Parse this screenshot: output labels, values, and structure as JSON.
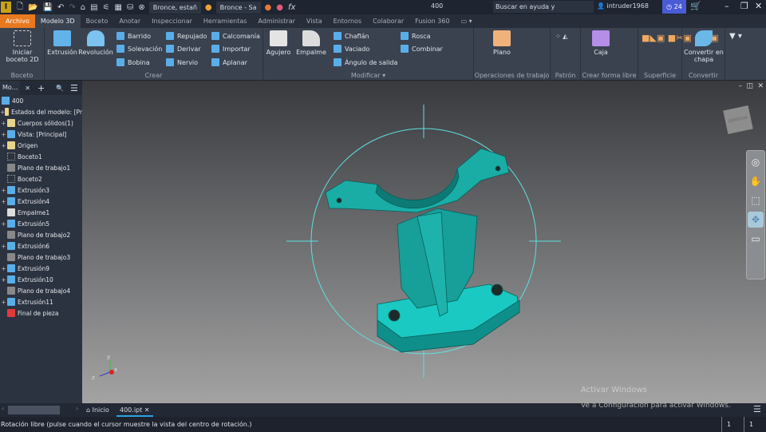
{
  "titlebar": {
    "logo": "I",
    "material": "Bronce, estañ",
    "appearance": "Bronce - Sa",
    "fx": "fx",
    "document": "400",
    "search_placeholder": "Buscar en ayuda y comandos...",
    "user": "intruder1968",
    "notifications": "24"
  },
  "tabs": [
    "Archivo",
    "Modelo 3D",
    "Boceto",
    "Anotar",
    "Inspeccionar",
    "Herramientas",
    "Administrar",
    "Vista",
    "Entornos",
    "Colaborar",
    "Fusion 360"
  ],
  "active_tab": "Modelo 3D",
  "ribbon": {
    "boceto": {
      "label": "Boceto",
      "start": "Iniciar boceto 2D"
    },
    "crear": {
      "label": "Crear",
      "extrusion": "Extrusión",
      "revolucion": "Revolución",
      "items": [
        "Barrido",
        "Solevación",
        "Bobina",
        "Repujado",
        "Derivar",
        "Nervio",
        "Calcomanía",
        "Importar",
        "Aplanar"
      ]
    },
    "modificar": {
      "label": "Modificar",
      "agujero": "Agujero",
      "empalme": "Empalme",
      "items": [
        "Chaflán",
        "Vaciado",
        "Ángulo de salida",
        "Rosca",
        "Combinar"
      ]
    },
    "operaciones": {
      "label": "Operaciones de trabajo",
      "plano": "Plano"
    },
    "patron": {
      "label": "Patrón"
    },
    "forma_libre": {
      "label": "Crear forma libre",
      "caja": "Caja"
    },
    "superficie": {
      "label": "Superficie"
    },
    "convertir": {
      "label": "Convertir",
      "chapa": "Convertir en chapa"
    }
  },
  "browser": {
    "title": "Mo...",
    "root": "400",
    "items": [
      {
        "label": "Estados del modelo: [Pr",
        "expand": true,
        "icon": "folder"
      },
      {
        "label": "Cuerpos sólidos(1)",
        "expand": true,
        "icon": "folder"
      },
      {
        "label": "Vista: [Principal]",
        "expand": true,
        "icon": "view"
      },
      {
        "label": "Origen",
        "expand": true,
        "icon": "folder"
      },
      {
        "label": "Boceto1",
        "expand": false,
        "icon": "sketch"
      },
      {
        "label": "Plano de trabajo1",
        "expand": false,
        "icon": "plane"
      },
      {
        "label": "Boceto2",
        "expand": false,
        "icon": "sketch"
      },
      {
        "label": "Extrusión3",
        "expand": true,
        "icon": "extrude"
      },
      {
        "label": "Extrusión4",
        "expand": true,
        "icon": "extrude"
      },
      {
        "label": "Empalme1",
        "expand": false,
        "icon": "fillet"
      },
      {
        "label": "Extrusión5",
        "expand": true,
        "icon": "extrude"
      },
      {
        "label": "Plano de trabajo2",
        "expand": false,
        "icon": "plane"
      },
      {
        "label": "Extrusión6",
        "expand": true,
        "icon": "extrude"
      },
      {
        "label": "Plano de trabajo3",
        "expand": false,
        "icon": "plane"
      },
      {
        "label": "Extrusión9",
        "expand": true,
        "icon": "extrude"
      },
      {
        "label": "Extrusión10",
        "expand": true,
        "icon": "extrude"
      },
      {
        "label": "Plano de trabajo4",
        "expand": false,
        "icon": "plane"
      },
      {
        "label": "Extrusión11",
        "expand": true,
        "icon": "extrude"
      },
      {
        "label": "Final de pieza",
        "expand": false,
        "icon": "end"
      }
    ]
  },
  "viewport": {
    "viewcube": "DERECHA",
    "model_color": "#1fb5ad",
    "orbit_color": "#5fe0e0",
    "axes": {
      "x": "x",
      "y": "y",
      "z": "z"
    }
  },
  "doctabs": {
    "home": "Inicio",
    "file": "400.ipt"
  },
  "watermark": {
    "title": "Activar Windows",
    "subtitle": "Ve a Configuración para activar Windows."
  },
  "status": {
    "message": "Rotación libre (pulse cuando el cursor muestre la vista del centro de rotación.)",
    "count1": "1",
    "count2": "1"
  }
}
